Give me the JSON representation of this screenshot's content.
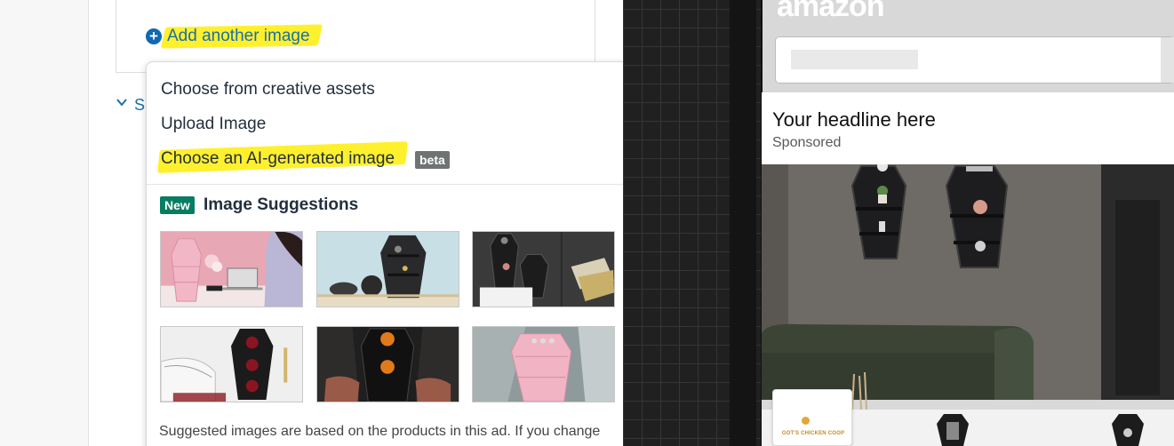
{
  "editor": {
    "add_image_label": "Add another image",
    "collapsed_section_label": "S"
  },
  "image_menu": {
    "items": [
      {
        "label": "Choose from creative assets"
      },
      {
        "label": "Upload Image"
      },
      {
        "label": "Choose an AI-generated image",
        "badge": "beta",
        "highlighted": true
      }
    ],
    "suggestions": {
      "badge": "New",
      "title": "Image Suggestions",
      "thumbnails": [
        {
          "name": "pink-coffin-shelf-desk",
          "icon": "image-thumbnail"
        },
        {
          "name": "black-coffin-shelf-light-wall",
          "icon": "image-thumbnail"
        },
        {
          "name": "black-coffin-shelves-dark-wall",
          "icon": "image-thumbnail"
        },
        {
          "name": "coffin-shelf-apples",
          "icon": "image-thumbnail"
        },
        {
          "name": "coffin-shelf-pumpkins-hands",
          "icon": "image-thumbnail"
        },
        {
          "name": "pink-coffin-shelf-grey-wall",
          "icon": "image-thumbnail"
        }
      ],
      "note": "Suggested images are based on the products in this ad. If you change"
    }
  },
  "preview": {
    "brand_logo": "amazon",
    "headline": "Your headline here",
    "sponsored": "Sponsored",
    "store_logo_text": "GOT'S CHICKEN COOP"
  },
  "colors": {
    "link": "#1a6fa7",
    "highlight": "#fff02e",
    "beta_badge": "#6f7373",
    "new_badge": "#067d62"
  }
}
